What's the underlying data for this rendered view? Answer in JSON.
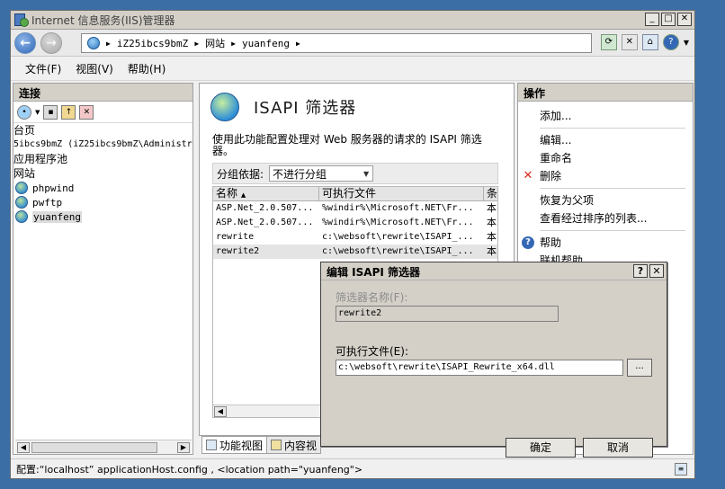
{
  "window": {
    "title": "Internet 信息服务(IIS)管理器"
  },
  "nav": {
    "back_label": "←",
    "forward_label": "→",
    "breadcrumb": [
      "iZ25ibcs9bmZ",
      "网站",
      "yuanfeng"
    ],
    "refresh_icon": "refresh-icon",
    "stop_icon": "stop-icon",
    "home_icon": "home-icon",
    "help_icon": "help-icon"
  },
  "menu": {
    "file": "文件(F)",
    "view": "视图(V)",
    "help": "帮助(H)"
  },
  "connections": {
    "header": "连接",
    "tree": {
      "start_page": "台页",
      "server": "5ibcs9bmZ (iZ25ibcs9bmZ\\Administr",
      "app_pools": "应用程序池",
      "sites": "网站",
      "site_items": [
        {
          "name": "phpwind"
        },
        {
          "name": "pwftp"
        },
        {
          "name": "yuanfeng"
        }
      ]
    }
  },
  "feature": {
    "title": "ISAPI 筛选器",
    "description": "使用此功能配置处理对 Web 服务器的请求的 ISAPI 筛选器。",
    "group_label": "分组依据:",
    "group_value": "不进行分组",
    "columns": [
      "名称",
      "可执行文件",
      "条"
    ],
    "rows": [
      {
        "name": "ASP.Net_2.0.507...",
        "exe": "%windir%\\Microsoft.NET\\Fr...",
        "cond": "本"
      },
      {
        "name": "ASP.Net_2.0.507...",
        "exe": "%windir%\\Microsoft.NET\\Fr...",
        "cond": "本"
      },
      {
        "name": "rewrite",
        "exe": "c:\\websoft\\rewrite\\ISAPI_...",
        "cond": "本"
      },
      {
        "name": "rewrite2",
        "exe": "c:\\websoft\\rewrite\\ISAPI_...",
        "cond": "本"
      }
    ],
    "tab_feature": "功能视图",
    "tab_content": "内容视"
  },
  "actions": {
    "header": "操作",
    "add": "添加...",
    "edit": "编辑...",
    "rename": "重命名",
    "delete": "删除",
    "revert": "恢复为父项",
    "ordered_list": "查看经过排序的列表...",
    "help": "帮助",
    "online_help": "联机帮助"
  },
  "status": {
    "text": "配置:“localhost” applicationHost.config , <location path=\"yuanfeng\">"
  },
  "dialog": {
    "title": "编辑 ISAPI 筛选器",
    "name_label": "筛选器名称(F):",
    "name_value": "rewrite2",
    "exe_label": "可执行文件(E):",
    "exe_value": "c:\\websoft\\rewrite\\ISAPI_Rewrite_x64.dll",
    "browse": "...",
    "ok": "确定",
    "cancel": "取消",
    "help_btn": "?",
    "close_btn": "✕"
  }
}
